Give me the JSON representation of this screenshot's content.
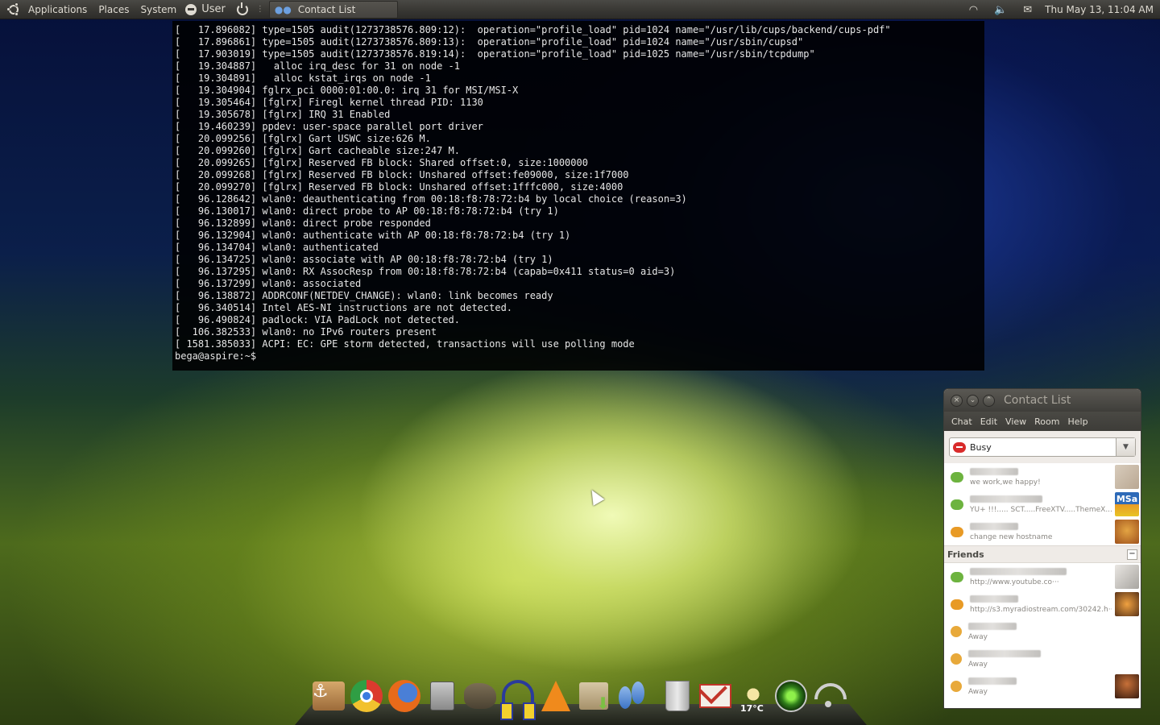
{
  "top_panel": {
    "menus": [
      "Applications",
      "Places",
      "System"
    ],
    "user_label": "User",
    "task_title": "Contact List",
    "clock": "Thu May 13, 11:04 AM",
    "tray_icons": [
      "wifi-icon",
      "volume-icon",
      "mail-icon"
    ]
  },
  "terminal": {
    "lines": [
      "[   17.896082] type=1505 audit(1273738576.809:12):  operation=\"profile_load\" pid=1024 name=\"/usr/lib/cups/backend/cups-pdf\"",
      "[   17.896861] type=1505 audit(1273738576.809:13):  operation=\"profile_load\" pid=1024 name=\"/usr/sbin/cupsd\"",
      "[   17.903019] type=1505 audit(1273738576.819:14):  operation=\"profile_load\" pid=1025 name=\"/usr/sbin/tcpdump\"",
      "[   19.304887]   alloc irq_desc for 31 on node -1",
      "[   19.304891]   alloc kstat_irqs on node -1",
      "[   19.304904] fglrx_pci 0000:01:00.0: irq 31 for MSI/MSI-X",
      "[   19.305464] [fglrx] Firegl kernel thread PID: 1130",
      "[   19.305678] [fglrx] IRQ 31 Enabled",
      "[   19.460239] ppdev: user-space parallel port driver",
      "[   20.099256] [fglrx] Gart USWC size:626 M.",
      "[   20.099260] [fglrx] Gart cacheable size:247 M.",
      "[   20.099265] [fglrx] Reserved FB block: Shared offset:0, size:1000000",
      "[   20.099268] [fglrx] Reserved FB block: Unshared offset:fe09000, size:1f7000",
      "[   20.099270] [fglrx] Reserved FB block: Unshared offset:1fffc000, size:4000",
      "[   96.128642] wlan0: deauthenticating from 00:18:f8:78:72:b4 by local choice (reason=3)",
      "[   96.130017] wlan0: direct probe to AP 00:18:f8:78:72:b4 (try 1)",
      "[   96.132899] wlan0: direct probe responded",
      "[   96.132904] wlan0: authenticate with AP 00:18:f8:78:72:b4 (try 1)",
      "[   96.134704] wlan0: authenticated",
      "[   96.134725] wlan0: associate with AP 00:18:f8:78:72:b4 (try 1)",
      "[   96.137295] wlan0: RX AssocResp from 00:18:f8:78:72:b4 (capab=0x411 status=0 aid=3)",
      "[   96.137299] wlan0: associated",
      "[   96.138872] ADDRCONF(NETDEV_CHANGE): wlan0: link becomes ready",
      "[   96.340514] Intel AES-NI instructions are not detected.",
      "[   96.490824] padlock: VIA PadLock not detected.",
      "[  106.382533] wlan0: no IPv6 routers present",
      "[ 1581.385033] ACPI: EC: GPE storm detected, transactions will use polling mode",
      "bega@aspire:~$ "
    ]
  },
  "contact_list": {
    "title": "Contact List",
    "menu": [
      "Chat",
      "Edit",
      "View",
      "Room",
      "Help"
    ],
    "status": "Busy",
    "group_name": "Friends",
    "collapse_label": "−",
    "top_contacts": [
      {
        "status_msg": "we work,we happy!",
        "bubble": "green"
      },
      {
        "status_msg": "YU+ !!!..... SCT.....FreeXTV.....ThemeX.....",
        "bubble": "green"
      },
      {
        "status_msg": "change new hostname",
        "bubble": "orange"
      }
    ],
    "friends": [
      {
        "status_msg": "http://www.youtube.co···",
        "bubble": "green"
      },
      {
        "status_msg": "http://s3.myradiostream.com/30242.h···",
        "bubble": "orange"
      },
      {
        "status_msg": "Away",
        "bubble": "away"
      },
      {
        "status_msg": "Away",
        "bubble": "away"
      },
      {
        "status_msg": "Away",
        "bubble": "away"
      }
    ],
    "avatar_badge": "MSa"
  },
  "dock": {
    "weather_temp": "17°C",
    "items": [
      "anchor-icon",
      "chrome-icon",
      "firefox-icon",
      "calculator-icon",
      "gimp-icon",
      "headphones-icon",
      "vlc-icon",
      "download-box-icon",
      "feet-icon",
      "trash-icon",
      "gmail-icon",
      "weather-icon",
      "radio-icon",
      "wifi-icon"
    ]
  }
}
